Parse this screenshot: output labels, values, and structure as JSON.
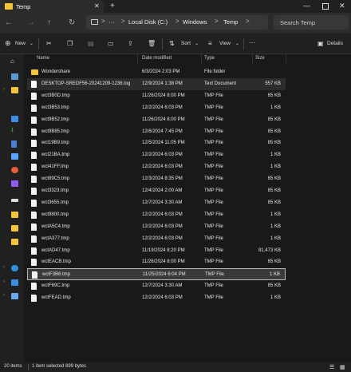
{
  "window": {
    "tab_title": "Temp",
    "tab_close": "✕",
    "new_tab": "+",
    "minimize": "—",
    "close": "✕"
  },
  "address": {
    "back": "←",
    "forward": "→",
    "up": "↑",
    "refresh": "↻",
    "ellipsis": "···",
    "crumbs": [
      "Local Disk (C:)",
      "Windows",
      "Temp"
    ],
    "separator": ">",
    "dropdown": ">",
    "search_placeholder": "Search Temp"
  },
  "toolbar": {
    "new_label": "New",
    "sort_label": "Sort",
    "view_label": "View",
    "more": "···",
    "details_label": "Details"
  },
  "columns": {
    "name": "Name",
    "date": "Date modified",
    "type": "Type",
    "size": "Size"
  },
  "files": [
    {
      "name": "Wondershare",
      "date": "6/3/2024 2:03 PM",
      "type": "File folder",
      "size": "",
      "kind": "folder"
    },
    {
      "name": "DESKTOP-SREDF56-20241209-1236.log",
      "date": "12/9/2024 1:38 PM",
      "type": "Text Document",
      "size": "557 KB",
      "kind": "doc"
    },
    {
      "name": "wct3B0D.tmp",
      "date": "11/26/2024 8:00 PM",
      "type": "TMP File",
      "size": "85 KB",
      "kind": "file"
    },
    {
      "name": "wct3B53.tmp",
      "date": "12/2/2024 6:03 PM",
      "type": "TMP File",
      "size": "1 KB",
      "kind": "file"
    },
    {
      "name": "wct9B52.tmp",
      "date": "11/26/2024 8:00 PM",
      "type": "TMP File",
      "size": "85 KB",
      "kind": "file"
    },
    {
      "name": "wct9B85.tmp",
      "date": "12/6/2024 7:45 PM",
      "type": "TMP File",
      "size": "85 KB",
      "kind": "file"
    },
    {
      "name": "wct19B9.tmp",
      "date": "12/5/2024 11:05 PM",
      "type": "TMP File",
      "size": "85 KB",
      "kind": "file"
    },
    {
      "name": "wct21BA.tmp",
      "date": "12/2/2024 6:03 PM",
      "type": "TMP File",
      "size": "1 KB",
      "kind": "file"
    },
    {
      "name": "wct41FF.tmp",
      "date": "12/2/2024 6:03 PM",
      "type": "TMP File",
      "size": "1 KB",
      "kind": "file"
    },
    {
      "name": "wct89C5.tmp",
      "date": "12/3/2024 8:35 PM",
      "type": "TMP File",
      "size": "85 KB",
      "kind": "file"
    },
    {
      "name": "wct3323.tmp",
      "date": "12/4/2024 2:00 AM",
      "type": "TMP File",
      "size": "85 KB",
      "kind": "file"
    },
    {
      "name": "wct3655.tmp",
      "date": "12/7/2024 3:30 AM",
      "type": "TMP File",
      "size": "85 KB",
      "kind": "file"
    },
    {
      "name": "wct9800.tmp",
      "date": "12/2/2024 6:03 PM",
      "type": "TMP File",
      "size": "1 KB",
      "kind": "file"
    },
    {
      "name": "wctA5C4.tmp",
      "date": "12/2/2024 6:03 PM",
      "type": "TMP File",
      "size": "1 KB",
      "kind": "file"
    },
    {
      "name": "wctA377.tmp",
      "date": "12/2/2024 6:03 PM",
      "type": "TMP File",
      "size": "1 KB",
      "kind": "file"
    },
    {
      "name": "wctAD47.tmp",
      "date": "11/19/2024 8:20 PM",
      "type": "TMP File",
      "size": "81,473 KB",
      "kind": "file"
    },
    {
      "name": "wctEACB.tmp",
      "date": "11/26/2024 8:00 PM",
      "type": "TMP File",
      "size": "85 KB",
      "kind": "file"
    },
    {
      "name": "wctF3B6.tmp",
      "date": "11/25/2024 6:04 PM",
      "type": "TMP File",
      "size": "1 KB",
      "kind": "file"
    },
    {
      "name": "wctF69C.tmp",
      "date": "12/7/2024 3:30 AM",
      "type": "TMP File",
      "size": "85 KB",
      "kind": "file"
    },
    {
      "name": "wctFEAD.tmp",
      "date": "12/2/2024 6:03 PM",
      "type": "TMP File",
      "size": "1 KB",
      "kind": "file"
    }
  ],
  "status": {
    "items": "20 items",
    "selected": "1 item selected  899 bytes"
  },
  "colors": {
    "folder": "#f3c53b",
    "selection": "#3a3a3a",
    "accent": "#4cc2ff"
  }
}
